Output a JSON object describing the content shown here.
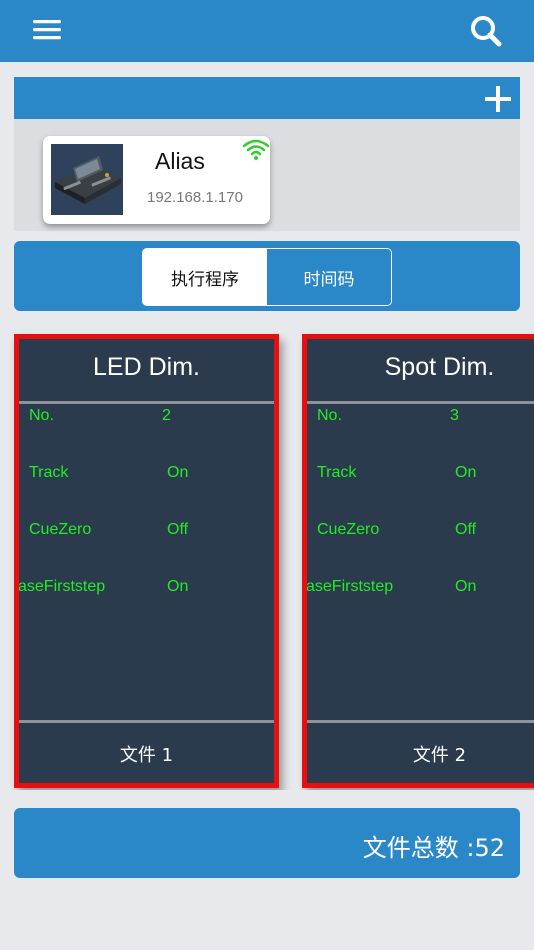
{
  "header": {
    "menu_icon": "hamburger-menu-icon",
    "search_icon": "search-icon",
    "color": "#2a88c9"
  },
  "device_panel": {
    "add_icon": "plus-icon",
    "device": {
      "name": "Alias",
      "ip": "192.168.1.170",
      "status_icon": "wifi-icon",
      "status_color": "#33cc33"
    }
  },
  "tabs": [
    {
      "label": "执行程序",
      "active": true
    },
    {
      "label": "时间码",
      "active": false
    }
  ],
  "files": [
    {
      "title": "LED Dim.",
      "props": [
        {
          "label": "No.",
          "value": "2"
        },
        {
          "label": "Track",
          "value": "On"
        },
        {
          "label": "CueZero",
          "value": "Off"
        },
        {
          "label": "aseFirststep",
          "value": "On"
        }
      ],
      "footer": "文件 1"
    },
    {
      "title": "Spot Dim.",
      "props": [
        {
          "label": "No.",
          "value": "3"
        },
        {
          "label": "Track",
          "value": "On"
        },
        {
          "label": "CueZero",
          "value": "Off"
        },
        {
          "label": "aseFirststep",
          "value": "On"
        }
      ],
      "footer": "文件 2"
    }
  ],
  "summary": {
    "total_label": "文件总数 :52"
  },
  "colors": {
    "accent": "#2a88c9",
    "card_bg": "#2b3a4c",
    "card_border": "#e80f10",
    "value_text": "#22ee22"
  }
}
